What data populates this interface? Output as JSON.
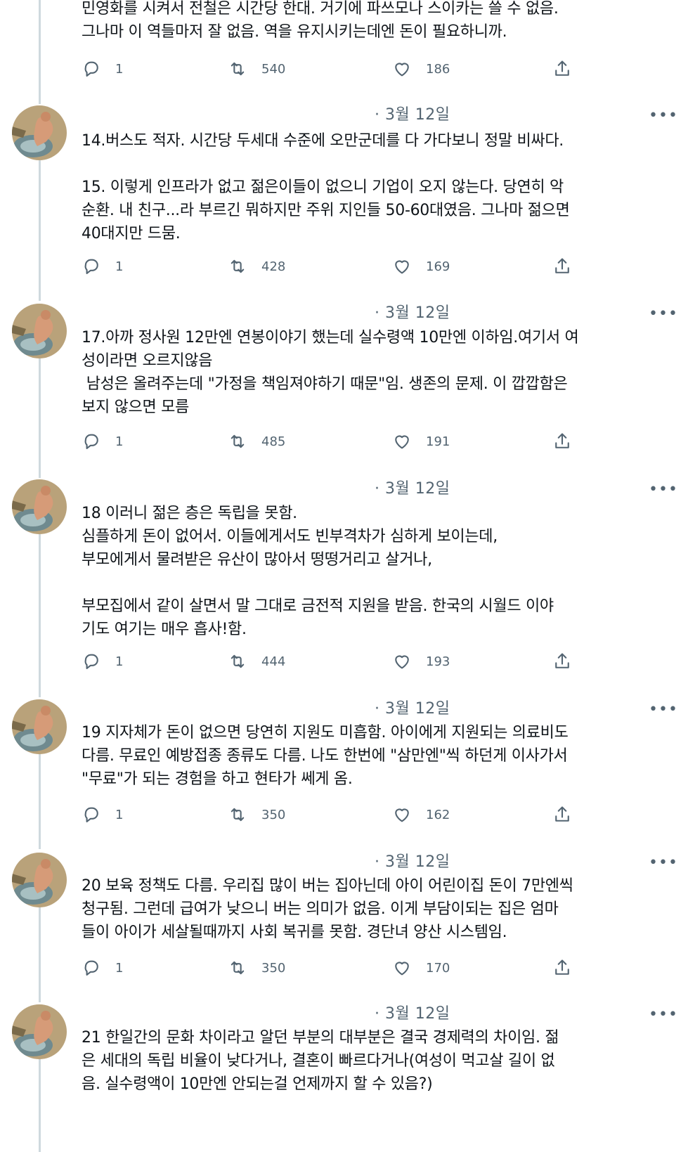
{
  "tweets": [
    {
      "date": "",
      "text": "민영화를 시켜서 전철은 시간당 한대. 거기에 파쓰모나 스이카는 쓸 수 없음.\n그나마 이 역들마저 잘 없음. 역을 유지시키는데엔 돈이 필요하니까.",
      "replies": "1",
      "retweets": "540",
      "likes": "186"
    },
    {
      "date": "· 3월 12일",
      "text": "14.버스도 적자. 시간당 두세대 수준에 오만군데를 다 가다보니 정말 비싸다.\n\n15. 이렇게 인프라가 없고 젊은이들이 없으니 기업이 오지 않는다. 당연히 악\n순환. 내 친구...라 부르긴 뭐하지만 주위 지인들 50-60대였음. 그나마 젊으면\n40대지만 드뭄.",
      "replies": "1",
      "retweets": "428",
      "likes": "169"
    },
    {
      "date": "· 3월 12일",
      "text": "17.아까 정사원 12만엔 연봉이야기 했는데 실수령액 10만엔 이하임.여기서 여\n성이라면 오르지않음\n 남성은 올려주는데 \"가정을 책임져야하기 때문\"임. 생존의 문제. 이 깝깝함은\n보지 않으면 모름",
      "replies": "1",
      "retweets": "485",
      "likes": "191"
    },
    {
      "date": "· 3월 12일",
      "text": "18 이러니 젊은 층은 독립을 못함.\n심플하게 돈이 없어서. 이들에게서도 빈부격차가 심하게 보이는데,\n부모에게서 물려받은 유산이 많아서 떵떵거리고 살거나,\n\n부모집에서 같이 살면서 말 그대로 금전적 지원을 받음. 한국의 시월드 이야\n기도 여기는 매우 흡사!함.",
      "replies": "1",
      "retweets": "444",
      "likes": "193"
    },
    {
      "date": "· 3월 12일",
      "text": "19 지자체가 돈이 없으면 당연히 지원도 미흡함. 아이에게 지원되는 의료비도\n다름. 무료인 예방접종 종류도 다름. 나도 한번에 \"삼만엔\"씩 하던게 이사가서\n\"무료\"가 되는 경험을 하고 현타가 쎄게 옴.",
      "replies": "1",
      "retweets": "350",
      "likes": "162"
    },
    {
      "date": "· 3월 12일",
      "text": "20 보육 정책도 다름. 우리집 많이 버는 집아닌데 아이 어린이집 돈이 7만엔씩\n청구됨. 그런데 급여가 낮으니 버는 의미가 없음. 이게 부담이되는 집은 엄마\n들이 아이가 세살될때까지 사회 복귀를 못함. 경단녀 양산 시스템임.",
      "replies": "1",
      "retweets": "350",
      "likes": "170"
    },
    {
      "date": "· 3월 12일",
      "text": "21 한일간의 문화 차이라고 알던 부분의 대부분은 결국 경제력의 차이임. 젊\n은 세대의 독립 비율이 낮다거나, 결혼이 빠르다거나(여성이 먹고살 길이 없\n음. 실수령액이 10만엔 안되는걸 언제까지 할 수 있음?)",
      "replies": "",
      "retweets": "",
      "likes": ""
    }
  ],
  "more_label": "•••",
  "icons": [
    "reply-icon",
    "retweet-icon",
    "like-icon",
    "share-icon",
    "more-icon",
    "avatar"
  ],
  "colors": {
    "muted": "#536471",
    "text": "#0f1419",
    "thread_line": "#cfd9de"
  }
}
